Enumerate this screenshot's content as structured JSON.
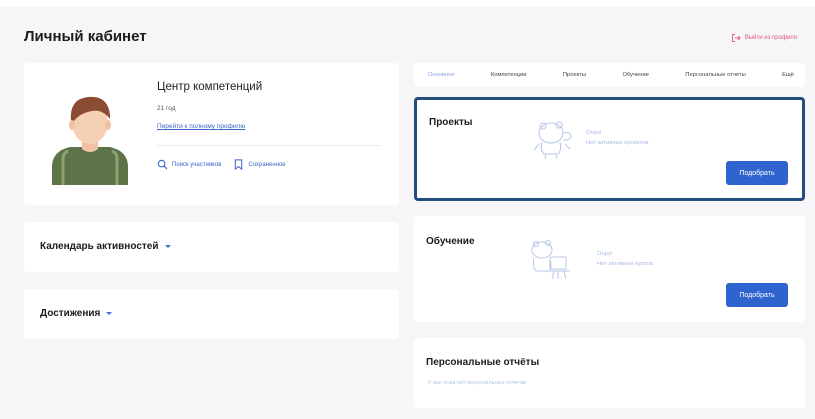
{
  "header": {
    "title": "Личный кабинет",
    "logout_label": "Выйти из профиля",
    "logout_color": "#e4587b"
  },
  "profile": {
    "name": "Центр компетенций",
    "age": "21 год",
    "full_profile_link": "Перейти к полному профилю",
    "actions": {
      "search_label": "Поиск участников",
      "saved_label": "Сохраненное"
    }
  },
  "sidebar": {
    "calendar_title": "Календарь активностей",
    "achievements_title": "Достижения"
  },
  "tabs": [
    {
      "label": "Основное",
      "active": true
    },
    {
      "label": "Компетенции",
      "active": false
    },
    {
      "label": "Проекты",
      "active": false
    },
    {
      "label": "Обучение",
      "active": false
    },
    {
      "label": "Персональные отчеты",
      "active": false
    },
    {
      "label": "Ещё",
      "active": false
    }
  ],
  "projects": {
    "title": "Проекты",
    "empty_title": "Oops!",
    "empty_text": "Нет активных проектов",
    "button_label": "Подобрать",
    "highlight_color": "#244d7f"
  },
  "education": {
    "title": "Обучение",
    "empty_title": "Oops!",
    "empty_text": "Нет активных курсов",
    "button_label": "Подобрать"
  },
  "reports": {
    "title": "Персональные отчёты",
    "empty_text": "У вас пока нет персональных отчетов"
  },
  "colors": {
    "accent": "#2f64cf",
    "link": "#3a63c8",
    "background": "#f6f6f8"
  },
  "icons": {
    "logout": "logout-icon",
    "search": "search-icon",
    "saved": "bookmark-icon",
    "caret": "chevron-down-icon"
  }
}
